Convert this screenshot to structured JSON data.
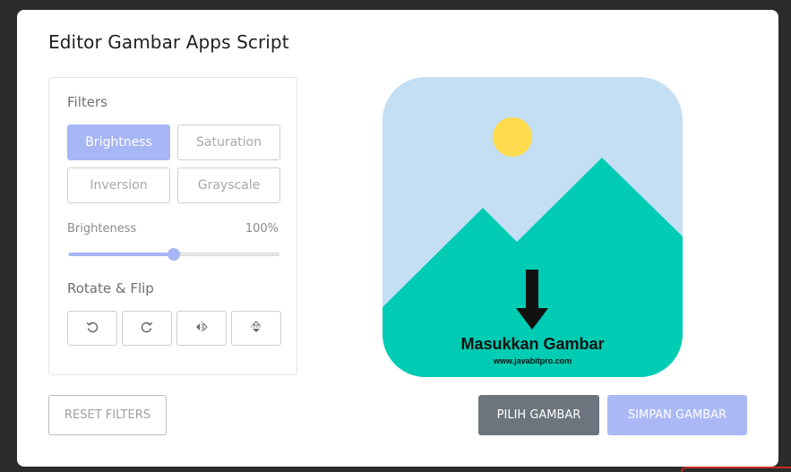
{
  "editor": {
    "title": "Editor Gambar Apps Script"
  },
  "filters": {
    "label": "Filters",
    "buttons": [
      {
        "label": "Brightness",
        "active": true
      },
      {
        "label": "Saturation",
        "active": false
      },
      {
        "label": "Inversion",
        "active": false
      },
      {
        "label": "Grayscale",
        "active": false
      }
    ]
  },
  "slider": {
    "name": "Brighteness",
    "value_text": "100%",
    "fill_fraction": 0.5
  },
  "rotate": {
    "label": "Rotate & Flip",
    "buttons": [
      {
        "icon": "rotate-left-icon"
      },
      {
        "icon": "rotate-right-icon"
      },
      {
        "icon": "flip-horizontal-icon"
      },
      {
        "icon": "flip-vertical-icon"
      }
    ]
  },
  "actions": {
    "reset": "RESET FILTERS",
    "choose": "PILIH GAMBAR",
    "save": "SIMPAN GAMBAR"
  },
  "preview": {
    "heading": "Masukkan Gambar",
    "url": "www.javabitpro.com",
    "colors": {
      "sky": "#c4dff4",
      "mountain": "#00ccb3",
      "sun": "#ffdb4d"
    }
  },
  "colors": {
    "accent": "#a7b6f4",
    "choose_button": "#6c757d"
  }
}
